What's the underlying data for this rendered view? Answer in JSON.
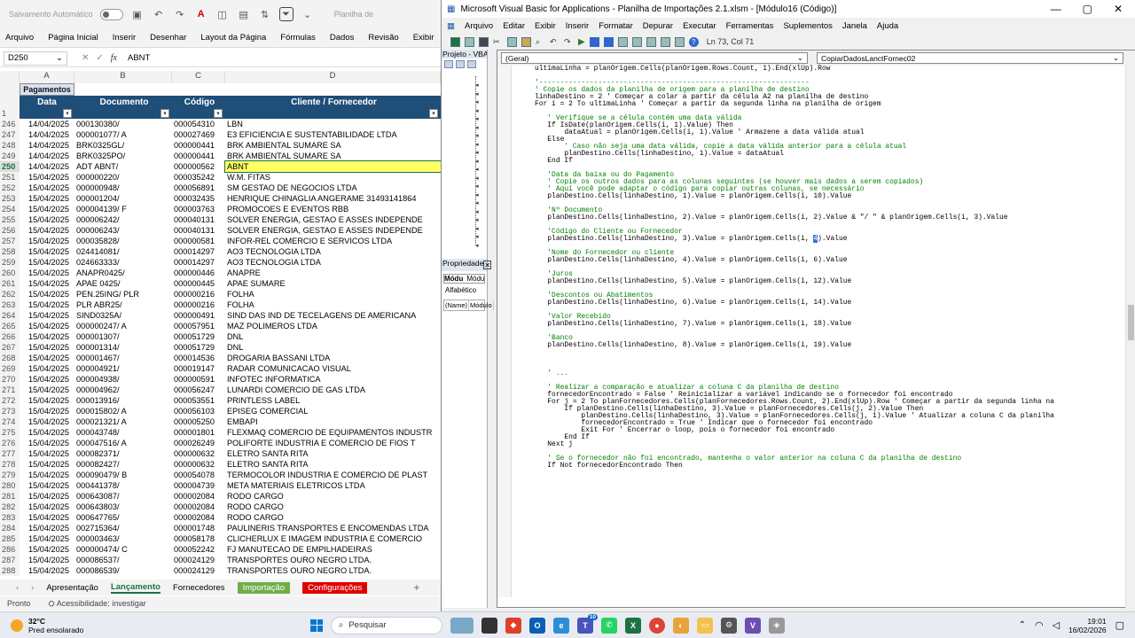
{
  "excel": {
    "autosave_label": "Salvamento Automático",
    "title_fragment": "Planilha de",
    "menu": [
      "Arquivo",
      "Página Inicial",
      "Inserir",
      "Desenhar",
      "Layout da Página",
      "Fórmulas",
      "Dados",
      "Revisão",
      "Exibir",
      "Automatizar"
    ],
    "namebox": "D250",
    "formula_value": "ABNT",
    "columns": [
      "A",
      "B",
      "C",
      "D"
    ],
    "group_label": "Pagamentos",
    "headers": [
      "Data",
      "Documento",
      "Código",
      "Cliente / Fornecedor"
    ],
    "header_row_number": "1",
    "rows": [
      {
        "n": "246",
        "a": "14/04/2025",
        "b": "000130380/",
        "c": "000054310",
        "d": "LBN"
      },
      {
        "n": "247",
        "a": "14/04/2025",
        "b": "000001077/ A",
        "c": "000027469",
        "d": "E3 EFICIENCIA E SUSTENTABILIDADE LTDA"
      },
      {
        "n": "248",
        "a": "14/04/2025",
        "b": "BRK0325GL/",
        "c": "000000441",
        "d": "BRK AMBIENTAL  SUMARE SA"
      },
      {
        "n": "249",
        "a": "14/04/2025",
        "b": "BRK0325PO/",
        "c": "000000441",
        "d": "BRK AMBIENTAL  SUMARE SA"
      },
      {
        "n": "250",
        "a": "14/04/2025",
        "b": "ADT ABNT/",
        "c": "000000562",
        "d": "ABNT",
        "selected": true
      },
      {
        "n": "251",
        "a": "15/04/2025",
        "b": "000000220/",
        "c": "000035242",
        "d": "W.M. FITAS"
      },
      {
        "n": "252",
        "a": "15/04/2025",
        "b": "000000948/",
        "c": "000056891",
        "d": "SM GESTAO DE NEGOCIOS LTDA"
      },
      {
        "n": "253",
        "a": "15/04/2025",
        "b": "000001204/",
        "c": "000032435",
        "d": "HENRIQUE CHINAGLIA ANGERAME 31493141864"
      },
      {
        "n": "254",
        "a": "15/04/2025",
        "b": "000004139/ F",
        "c": "000003763",
        "d": "PROMOCOES E EVENTOS RBB"
      },
      {
        "n": "255",
        "a": "15/04/2025",
        "b": "000006242/",
        "c": "000040131",
        "d": "SOLVER ENERGIA, GESTAO E ASSES INDEPENDE"
      },
      {
        "n": "256",
        "a": "15/04/2025",
        "b": "000006243/",
        "c": "000040131",
        "d": "SOLVER ENERGIA, GESTAO E ASSES INDEPENDE"
      },
      {
        "n": "257",
        "a": "15/04/2025",
        "b": "000035828/",
        "c": "000000581",
        "d": "INFOR-REL COMERCIO E SERVICOS LTDA"
      },
      {
        "n": "258",
        "a": "15/04/2025",
        "b": "024414081/",
        "c": "000014297",
        "d": "AO3 TECNOLOGIA LTDA"
      },
      {
        "n": "259",
        "a": "15/04/2025",
        "b": "024663333/",
        "c": "000014297",
        "d": "AO3 TECNOLOGIA LTDA"
      },
      {
        "n": "260",
        "a": "15/04/2025",
        "b": "ANAPR0425/",
        "c": "000000446",
        "d": "ANAPRE"
      },
      {
        "n": "261",
        "a": "15/04/2025",
        "b": "APAE 0425/",
        "c": "000000445",
        "d": "APAE SUMARE"
      },
      {
        "n": "262",
        "a": "15/04/2025",
        "b": "PEN.25ING/ PLR",
        "c": "000000216",
        "d": "FOLHA"
      },
      {
        "n": "263",
        "a": "15/04/2025",
        "b": "PLR ABR25/",
        "c": "000000216",
        "d": "FOLHA"
      },
      {
        "n": "264",
        "a": "15/04/2025",
        "b": "SIND0325A/",
        "c": "000000491",
        "d": "SIND DAS IND DE TECELAGENS DE AMERICANA"
      },
      {
        "n": "265",
        "a": "15/04/2025",
        "b": "000000247/ A",
        "c": "000057951",
        "d": "MAZ POLIMEROS LTDA"
      },
      {
        "n": "266",
        "a": "15/04/2025",
        "b": "000001307/",
        "c": "000051729",
        "d": "DNL"
      },
      {
        "n": "267",
        "a": "15/04/2025",
        "b": "000001314/",
        "c": "000051729",
        "d": "DNL"
      },
      {
        "n": "268",
        "a": "15/04/2025",
        "b": "000001467/",
        "c": "000014536",
        "d": "DROGARIA BASSANI LTDA"
      },
      {
        "n": "269",
        "a": "15/04/2025",
        "b": "000004921/",
        "c": "000019147",
        "d": "RADAR COMUNICACAO VISUAL"
      },
      {
        "n": "270",
        "a": "15/04/2025",
        "b": "000004938/",
        "c": "000000591",
        "d": "INFOTEC INFORMATICA"
      },
      {
        "n": "271",
        "a": "15/04/2025",
        "b": "000004962/",
        "c": "000056247",
        "d": "LUNARDI COMERCIO DE GAS LTDA"
      },
      {
        "n": "272",
        "a": "15/04/2025",
        "b": "000013916/",
        "c": "000053551",
        "d": "PRINTLESS LABEL"
      },
      {
        "n": "273",
        "a": "15/04/2025",
        "b": "000015802/ A",
        "c": "000056103",
        "d": "EPISEG COMERCIAL"
      },
      {
        "n": "274",
        "a": "15/04/2025",
        "b": "000021321/ A",
        "c": "000005250",
        "d": "EMBAPI"
      },
      {
        "n": "275",
        "a": "15/04/2025",
        "b": "000043748/",
        "c": "000001801",
        "d": "FLEXMAQ COMERCIO DE EQUIPAMENTOS INDUSTR"
      },
      {
        "n": "276",
        "a": "15/04/2025",
        "b": "000047516/ A",
        "c": "000026249",
        "d": "POLIFORTE INDUSTRIA E COMERCIO DE FIOS T"
      },
      {
        "n": "277",
        "a": "15/04/2025",
        "b": "000082371/",
        "c": "000000632",
        "d": "ELETRO SANTA RITA"
      },
      {
        "n": "278",
        "a": "15/04/2025",
        "b": "000082427/",
        "c": "000000632",
        "d": "ELETRO SANTA RITA"
      },
      {
        "n": "279",
        "a": "15/04/2025",
        "b": "000090479/ B",
        "c": "000054078",
        "d": "TERMOCOLOR INDUSTRIA E COMERCIO DE PLAST"
      },
      {
        "n": "280",
        "a": "15/04/2025",
        "b": "000441378/",
        "c": "000004739",
        "d": "META MATERIAIS ELETRICOS LTDA"
      },
      {
        "n": "281",
        "a": "15/04/2025",
        "b": "000643087/",
        "c": "000002084",
        "d": "RODO CARGO"
      },
      {
        "n": "282",
        "a": "15/04/2025",
        "b": "000643803/",
        "c": "000002084",
        "d": "RODO CARGO"
      },
      {
        "n": "283",
        "a": "15/04/2025",
        "b": "000647765/",
        "c": "000002084",
        "d": "RODO CARGO"
      },
      {
        "n": "284",
        "a": "15/04/2025",
        "b": "002715364/",
        "c": "000001748",
        "d": "PAULINERIS TRANSPORTES E ENCOMENDAS LTDA"
      },
      {
        "n": "285",
        "a": "15/04/2025",
        "b": "000003463/",
        "c": "000058178",
        "d": "CLICHERLUX E IMAGEM INDUSTRIA E COMERCIO"
      },
      {
        "n": "286",
        "a": "15/04/2025",
        "b": "000000474/ C",
        "c": "000052242",
        "d": "FJ MANUTECAO DE EMPILHADEIRAS"
      },
      {
        "n": "287",
        "a": "15/04/2025",
        "b": "000086537/",
        "c": "000024129",
        "d": "TRANSPORTES OURO NEGRO LTDA."
      },
      {
        "n": "288",
        "a": "15/04/2025",
        "b": "000086539/",
        "c": "000024129",
        "d": "TRANSPORTES OURO NEGRO LTDA."
      }
    ],
    "tabs": [
      "Apresentação",
      "Lançamento",
      "Fornecedores",
      "Importação",
      "Configurações"
    ],
    "status_ready": "Pronto",
    "status_accessibility": "Acessibilidade: investigar"
  },
  "vba": {
    "title": "Microsoft Visual Basic for Applications - Planilha de Importações 2.1.xlsm - [Módulo16 (Código)]",
    "menu": [
      "Arquivo",
      "Editar",
      "Exibir",
      "Inserir",
      "Formatar",
      "Depurar",
      "Executar",
      "Ferramentas",
      "Suplementos",
      "Janela",
      "Ajuda"
    ],
    "cursor_pos": "Ln 73, Col 71",
    "project_title": "Projeto - VBA",
    "properties_title": "Propriedade",
    "prop_combo_left": "Módu",
    "prop_combo_right": "Módu",
    "prop_tab": "Alfabético",
    "prop_name": "(Name)",
    "prop_value": "Módulo",
    "object_combo": "(Geral)",
    "proc_combo": "CopiarDadosLanctFornec02",
    "code_lines": [
      {
        "t": "ultimaLinha = planOrigem.Cells(planOrigem.Rows.Count, 1).End(xlUp).Row"
      },
      {
        "t": ""
      },
      {
        "t": "'----------------------------------------------------------------",
        "c": 1
      },
      {
        "t": "' Copie os dados da planilha de origem para a planilha de destino",
        "c": 1
      },
      {
        "t": "linhaDestino = 2 ' Começar a colar a partir da célula A2 na planilha de destino"
      },
      {
        "t": "For i = 2 To ultimaLinha ' Começar a partir da segunda linha na planilha de origem"
      },
      {
        "t": ""
      },
      {
        "t": "   ' Verifique se a célula contém uma data válida",
        "c": 1
      },
      {
        "t": "   If IsDate(planOrigem.Cells(i, 1).Value) Then"
      },
      {
        "t": "       dataAtual = planOrigem.Cells(i, 1).Value ' Armazene a data válida atual"
      },
      {
        "t": "   Else"
      },
      {
        "t": "       ' Caso não seja uma data válida, copie a data válida anterior para a célula atual",
        "c": 1
      },
      {
        "t": "       planDestino.Cells(linhaDestino, 1).Value = dataAtual"
      },
      {
        "t": "   End If"
      },
      {
        "t": ""
      },
      {
        "t": "   'Data da baixa ou do Pagamento",
        "c": 1
      },
      {
        "t": "   ' Copie os outros dados para as colunas seguintes (se houver mais dados a serem copiados)",
        "c": 1
      },
      {
        "t": "   ' Aqui você pode adaptar o código para copiar outras colunas, se necessário",
        "c": 1
      },
      {
        "t": "   planDestino.Cells(linhaDestino, 1).Value = planOrigem.Cells(i, 10).Value"
      },
      {
        "t": ""
      },
      {
        "t": "   'Nº Documento",
        "c": 1
      },
      {
        "t": "   planDestino.Cells(linhaDestino, 2).Value = planOrigem.Cells(i, 2).Value & \"/ \" & planOrigem.Cells(i, 3).Value"
      },
      {
        "t": ""
      },
      {
        "t": "   'Código do Cliente ou Fornecedor",
        "c": 1
      },
      {
        "t": "   planDestino.Cells(linhaDestino, 3).Value = planOrigem.Cells(i, ",
        "hl": "4",
        "after": ").Value"
      },
      {
        "t": ""
      },
      {
        "t": "   'Nome do Fornecedor ou cliente",
        "c": 1
      },
      {
        "t": "   planDestino.Cells(linhaDestino, 4).Value = planOrigem.Cells(i, 6).Value"
      },
      {
        "t": ""
      },
      {
        "t": "   'Juros",
        "c": 1
      },
      {
        "t": "   planDestino.Cells(linhaDestino, 5).Value = planOrigem.Cells(i, 12).Value"
      },
      {
        "t": ""
      },
      {
        "t": "   'Descontos ou Abatimentos",
        "c": 1
      },
      {
        "t": "   planDestino.Cells(linhaDestino, 6).Value = planOrigem.Cells(i, 14).Value"
      },
      {
        "t": ""
      },
      {
        "t": "   'Valor Recebido",
        "c": 1
      },
      {
        "t": "   planDestino.Cells(linhaDestino, 7).Value = planOrigem.Cells(i, 18).Value"
      },
      {
        "t": ""
      },
      {
        "t": "   'Banco",
        "c": 1
      },
      {
        "t": "   planDestino.Cells(linhaDestino, 8).Value = planOrigem.Cells(i, 19).Value"
      },
      {
        "t": ""
      },
      {
        "t": ""
      },
      {
        "t": ""
      },
      {
        "t": "   ' ...",
        "c": 1
      },
      {
        "t": ""
      },
      {
        "t": "   ' Realizar a comparação e atualizar a coluna C da planilha de destino",
        "c": 1
      },
      {
        "t": "   fornecedorEncontrado = False ' Reinicializar a variável indicando se o fornecedor foi encontrado"
      },
      {
        "t": "   For j = 2 To planFornecedores.Cells(planFornecedores.Rows.Count, 2).End(xlUp).Row ' Começar a partir da segunda linha na"
      },
      {
        "t": "       If planDestino.Cells(linhaDestino, 3).Value = planFornecedores.Cells(j, 2).Value Then"
      },
      {
        "t": "           planDestino.Cells(linhaDestino, 3).Value = planFornecedores.Cells(j, 1).Value ' Atualizar a coluna C da planilha"
      },
      {
        "t": "           fornecedorEncontrado = True ' Indicar que o fornecedor foi encontrado"
      },
      {
        "t": "           Exit For ' Encerrar o loop, pois o fornecedor foi encontrado"
      },
      {
        "t": "       End If"
      },
      {
        "t": "   Next j"
      },
      {
        "t": ""
      },
      {
        "t": "   ' Se o fornecedor não foi encontrado, mantenha o valor anterior na coluna C da planilha de destino",
        "c": 1
      },
      {
        "t": "   If Not fornecedorEncontrado Then"
      }
    ]
  },
  "taskbar": {
    "temperature": "32°C",
    "weather": "Pred ensolarado",
    "search": "Pesquisar",
    "mail_badge": "10",
    "time": "19:01",
    "date": "16/02/2026"
  }
}
